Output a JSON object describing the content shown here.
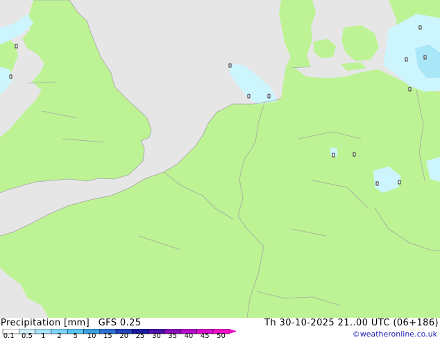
{
  "header": {
    "title": "Precipitation [mm]",
    "model": "GFS 0.25",
    "valid_time": "Th 30-10-2025 21..00 UTC (06+186)",
    "credit": "©weatheronline.co.uk"
  },
  "legend": {
    "ticks": [
      "0.1",
      "0.5",
      "1",
      "2",
      "5",
      "10",
      "15",
      "20",
      "25",
      "30",
      "35",
      "40",
      "45",
      "50"
    ],
    "colors": [
      "#ffffff",
      "#cdeffd",
      "#a6e4fb",
      "#7dd6f7",
      "#55c3f0",
      "#3a9fe0",
      "#2f6fd0",
      "#2442b8",
      "#1a1aa0",
      "#4b0fa8",
      "#8a0cb8",
      "#b60cc8",
      "#d80ccc",
      "#f010c8"
    ]
  },
  "map": {
    "colors": {
      "sea": "#e6e6e6",
      "land": "#bdf394",
      "precip_light": "#cdf5fd",
      "precip_mid": "#a8e6f8",
      "border": "#a4a4a4"
    },
    "layers": [
      "sea",
      "land",
      "precipitation",
      "borders",
      "station-markers"
    ]
  }
}
